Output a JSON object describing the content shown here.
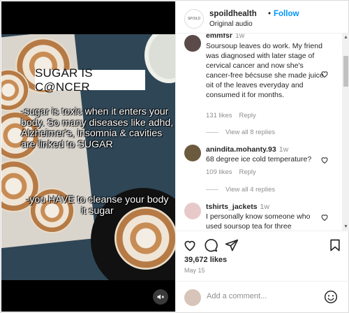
{
  "post": {
    "headline": "SUGAR IS C@NCER",
    "overlay_line1": "-sugar is toxic when it enters your body. So many diseases like adhd, Alzheimer's, insomnia & cavities are linked to SUGAR",
    "overlay_line2": "-you HAVE to cleanse your body it sugar"
  },
  "header": {
    "avatar_text": "SPOILD",
    "username": "spoildhealth",
    "separator": "•",
    "follow_label": "Follow",
    "audio": "Original audio"
  },
  "comments": [
    {
      "username": "emmfsr",
      "time": "1w",
      "text": "Soursoup leaves do work. My friend was diagnosed with later stage of cervical cancer and now she's cancer-free bécsuse she made juice oit of the leaves everyday and consumed it for months.",
      "likes": "131 likes",
      "reply": "Reply",
      "view_replies": "View all 8 replies"
    },
    {
      "username": "anindita.mohanty.93",
      "time": "1w",
      "text": "68 degree ice cold temperature?",
      "likes": "109 likes",
      "reply": "Reply",
      "view_replies": "View all 4 replies"
    },
    {
      "username": "tshirts_jackets",
      "time": "1w",
      "text": "I personally know someone who used soursop tea for three"
    }
  ],
  "footer": {
    "likes": "39,672 likes",
    "date": "May 15"
  },
  "composer": {
    "placeholder": "Add a comment..."
  }
}
